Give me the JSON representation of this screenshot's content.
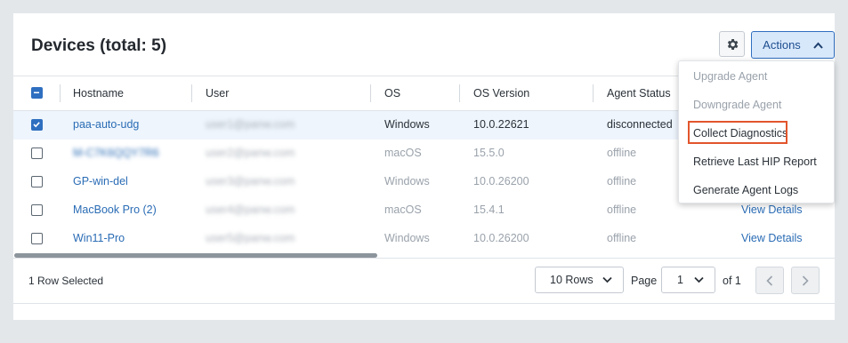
{
  "header": {
    "title": "Devices (total: 5)",
    "actions_label": "Actions",
    "settings_icon": "gear-icon"
  },
  "table": {
    "columns": [
      "Hostname",
      "User",
      "OS",
      "OS Version",
      "Agent Status"
    ],
    "rows": [
      {
        "hostname": "paa-auto-udg",
        "user": "user1@panw.com",
        "os": "Windows",
        "os_version": "10.0.22621",
        "status": "disconnected",
        "details": "",
        "selected": true
      },
      {
        "hostname": "M-C7K6QQY7R6",
        "user": "user2@panw.com",
        "os": "macOS",
        "os_version": "15.5.0",
        "status": "offline",
        "details": "",
        "selected": false
      },
      {
        "hostname": "GP-win-del",
        "user": "user3@panw.com",
        "os": "Windows",
        "os_version": "10.0.26200",
        "status": "offline",
        "details": "",
        "selected": false
      },
      {
        "hostname": "MacBook Pro (2)",
        "user": "user4@panw.com",
        "os": "macOS",
        "os_version": "15.4.1",
        "status": "offline",
        "details": "View Details",
        "selected": false
      },
      {
        "hostname": "Win11-Pro",
        "user": "user5@panw.com",
        "os": "Windows",
        "os_version": "10.0.26200",
        "status": "offline",
        "details": "View Details",
        "selected": false
      }
    ]
  },
  "footer": {
    "selected_text": "1 Row Selected",
    "rows_per_page": "10 Rows",
    "page_label": "Page",
    "page_value": "1",
    "of_label": "of 1"
  },
  "actions_menu": {
    "items": [
      {
        "label": "Upgrade Agent",
        "enabled": false
      },
      {
        "label": "Downgrade Agent",
        "enabled": false
      },
      {
        "label": "Collect Diagnostics",
        "enabled": true,
        "highlighted": true
      },
      {
        "label": "Retrieve Last HIP Report",
        "enabled": true
      },
      {
        "label": "Generate Agent Logs",
        "enabled": true
      }
    ]
  },
  "colors": {
    "accent": "#2f6fc0",
    "link": "#2a6cb5",
    "highlight": "#e2552c",
    "selected_row": "#eef5fc"
  }
}
